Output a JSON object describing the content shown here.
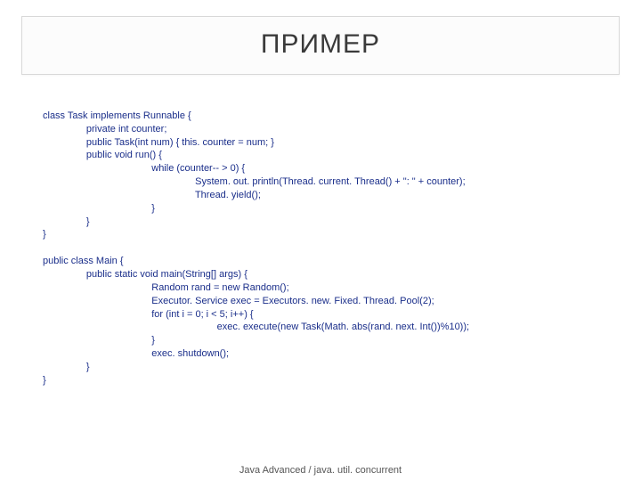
{
  "title": "ПРИМЕР",
  "code": {
    "l1": "class Task implements Runnable {",
    "l2": "                private int counter;",
    "l3": "                public Task(int num) { this. counter = num; }",
    "l4": "                public void run() {",
    "l5": "                                        while (counter-- > 0) {",
    "l6": "                                                        System. out. println(Thread. current. Thread() + \": \" + counter);",
    "l7": "                                                        Thread. yield();",
    "l8": "                                        }",
    "l9": "                }",
    "l10": "}",
    "l11": "",
    "l12": "public class Main {",
    "l13": "                public static void main(String[] args) {",
    "l14": "                                        Random rand = new Random();",
    "l15": "                                        Executor. Service exec = Executors. new. Fixed. Thread. Pool(2);",
    "l16": "                                        for (int i = 0; i < 5; i++) {",
    "l17": "                                                                exec. execute(new Task(Math. abs(rand. next. Int())%10));",
    "l18": "                                        }",
    "l19": "                                        exec. shutdown();",
    "l20": "                }",
    "l21": "}"
  },
  "footer": "Java Advanced / java. util. concurrent"
}
